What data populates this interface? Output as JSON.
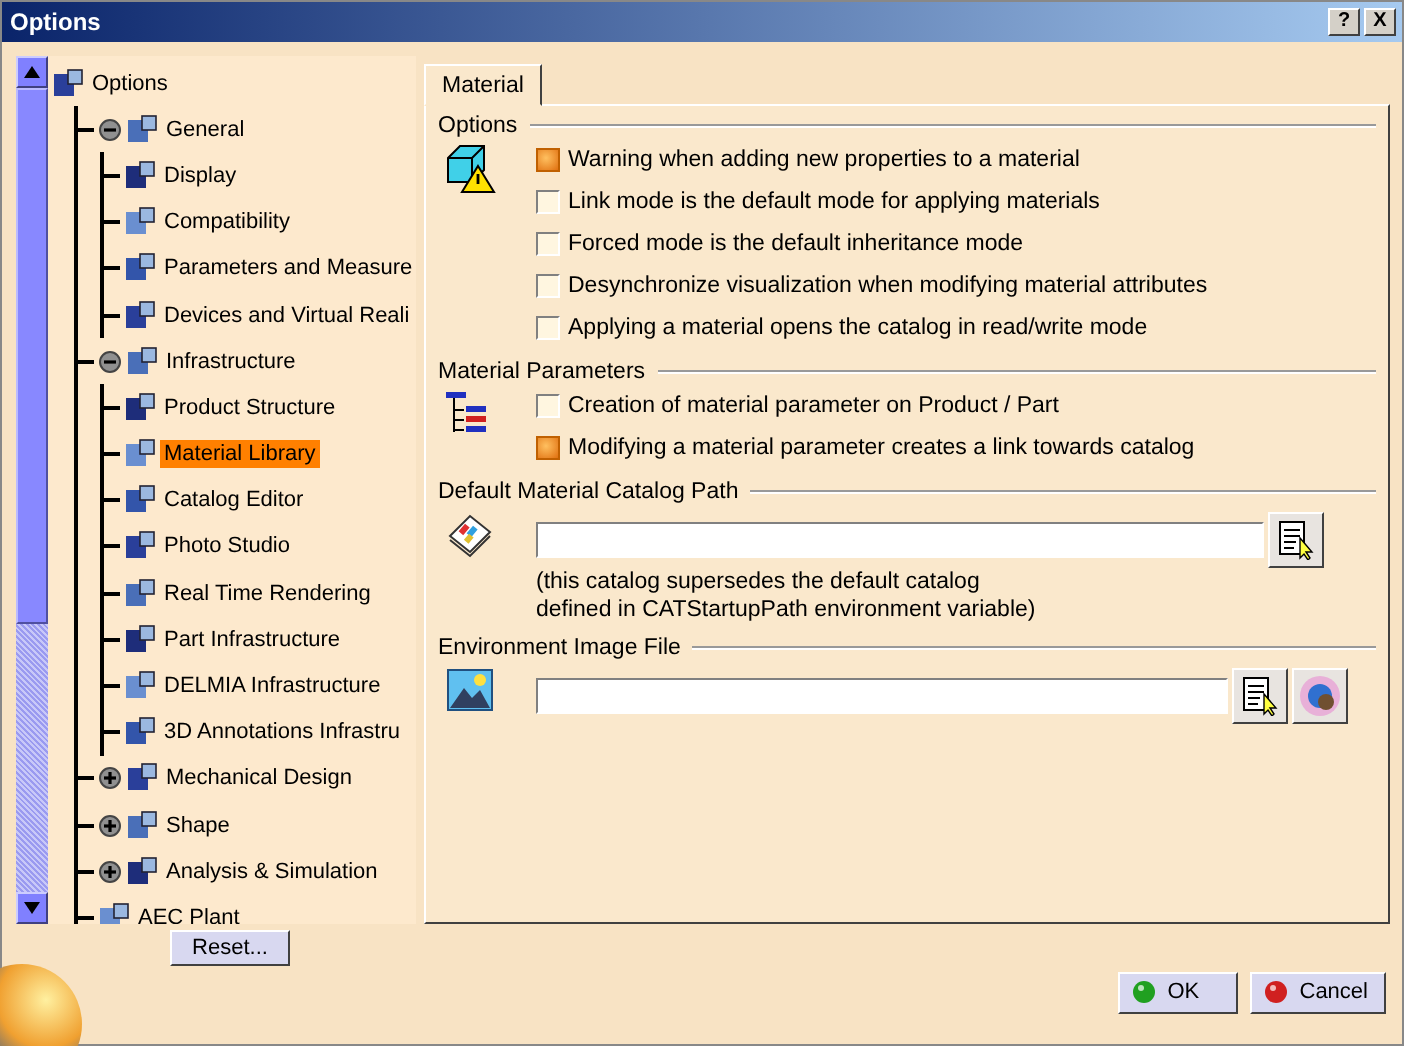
{
  "window": {
    "title": "Options",
    "buttons": [
      "?",
      "X"
    ]
  },
  "tree": {
    "items": [
      {
        "label": "Options",
        "selected": false,
        "children": [
          {
            "label": "General",
            "expanded": true,
            "selected": false,
            "children": [
              {
                "label": "Display",
                "selected": false
              },
              {
                "label": "Compatibility",
                "selected": false
              },
              {
                "label": "Parameters and Measure",
                "selected": false
              },
              {
                "label": "Devices and Virtual Reali",
                "selected": false
              }
            ]
          },
          {
            "label": "Infrastructure",
            "expanded": true,
            "selected": false,
            "children": [
              {
                "label": "Product Structure",
                "selected": false
              },
              {
                "label": "Material Library",
                "selected": true
              },
              {
                "label": "Catalog Editor",
                "selected": false
              },
              {
                "label": "Photo Studio",
                "selected": false
              },
              {
                "label": "Real Time Rendering",
                "selected": false
              },
              {
                "label": "Part Infrastructure",
                "selected": false
              },
              {
                "label": "DELMIA Infrastructure",
                "selected": false
              },
              {
                "label": "3D Annotations Infrastru",
                "selected": false
              }
            ]
          },
          {
            "label": "Mechanical Design",
            "expanded": false,
            "selected": false
          },
          {
            "label": "Shape",
            "expanded": false,
            "selected": false
          },
          {
            "label": "Analysis & Simulation",
            "expanded": false,
            "selected": false
          },
          {
            "label": "AEC Plant",
            "selected": false
          }
        ]
      }
    ]
  },
  "reset_button": "Reset...",
  "tabs": [
    {
      "label": "Material",
      "selected": true
    }
  ],
  "sections": [
    {
      "title": "Options",
      "kind": "checks",
      "options": [
        {
          "label": "Warning when adding new properties to a material",
          "checked": true
        },
        {
          "label": "Link mode is the default mode for applying materials",
          "checked": false
        },
        {
          "label": "Forced mode is the default inheritance mode",
          "checked": false
        },
        {
          "label": "Desynchronize visualization when modifying material attributes",
          "checked": false
        },
        {
          "label": "Applying a material opens the catalog in read/write mode",
          "checked": false
        }
      ]
    },
    {
      "title": "Material Parameters",
      "kind": "params",
      "options": [
        {
          "label": "Creation of material parameter on Product / Part",
          "checked": false
        },
        {
          "label": "Modifying a material parameter creates a link towards catalog",
          "checked": true
        }
      ]
    },
    {
      "title": "Default Material Catalog Path",
      "kind": "catalog",
      "note_lines": [
        "(this catalog supersedes the default catalog",
        "defined in CATStartupPath environment variable)"
      ]
    },
    {
      "title": "Environment Image File",
      "kind": "image"
    }
  ],
  "dialog_buttons": [
    {
      "label": "OK",
      "kind": "ok"
    },
    {
      "label": "Cancel",
      "kind": "cancel"
    }
  ]
}
